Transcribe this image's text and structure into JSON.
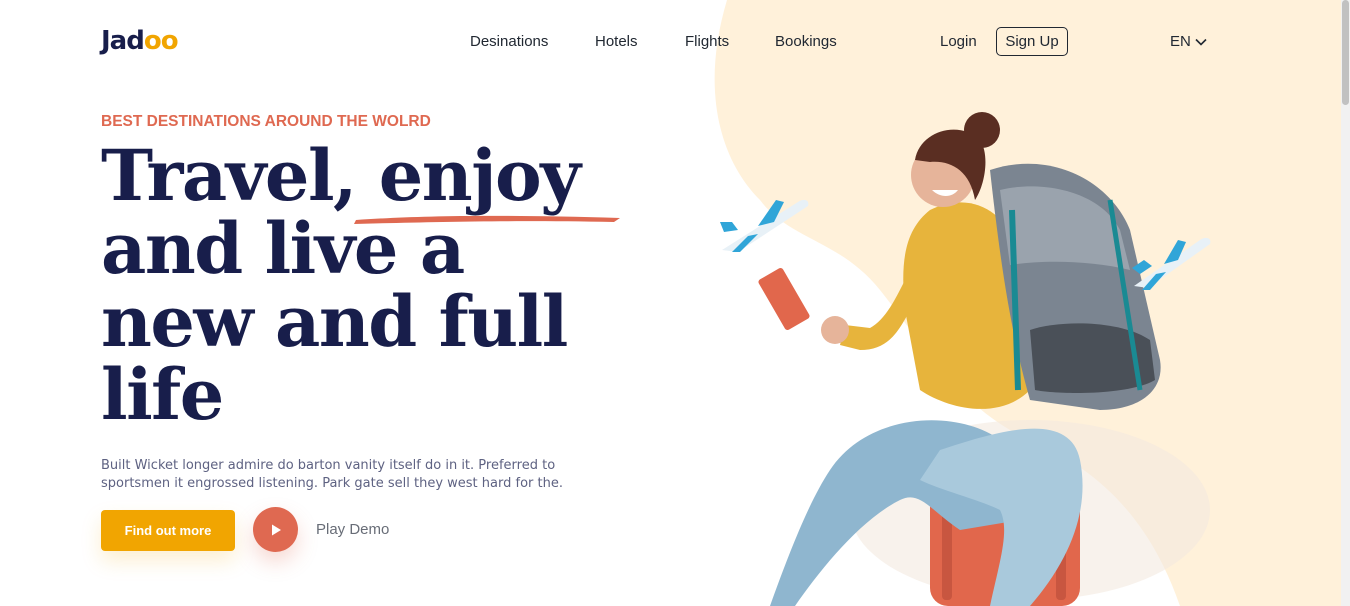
{
  "brand": {
    "logo_prefix": "Jad",
    "logo_accent": "oo"
  },
  "nav": {
    "items": [
      "Desinations",
      "Hotels",
      "Flights",
      "Bookings"
    ],
    "login": "Login",
    "signup": "Sign Up",
    "language": "EN"
  },
  "hero": {
    "eyebrow": "BEST DESTINATIONS AROUND THE WOLRD",
    "title_line1": "Travel, enjoy",
    "title_line2": "and live a",
    "title_line3": "new and full",
    "title_line4": "life",
    "description": "Built Wicket longer admire do barton vanity itself do in it. Preferred to sportsmen it engrossed listening. Park gate sell they west hard for the.",
    "cta_label": "Find out more",
    "play_label": "Play Demo"
  },
  "colors": {
    "primary": "#F1A501",
    "accent": "#DF6951",
    "heading": "#181E4B",
    "blob": "#FFF1DA",
    "text": "#5E6282"
  },
  "icons": {
    "play": "play-icon",
    "chevron": "chevron-down-icon",
    "plane": "airplane-icon"
  }
}
